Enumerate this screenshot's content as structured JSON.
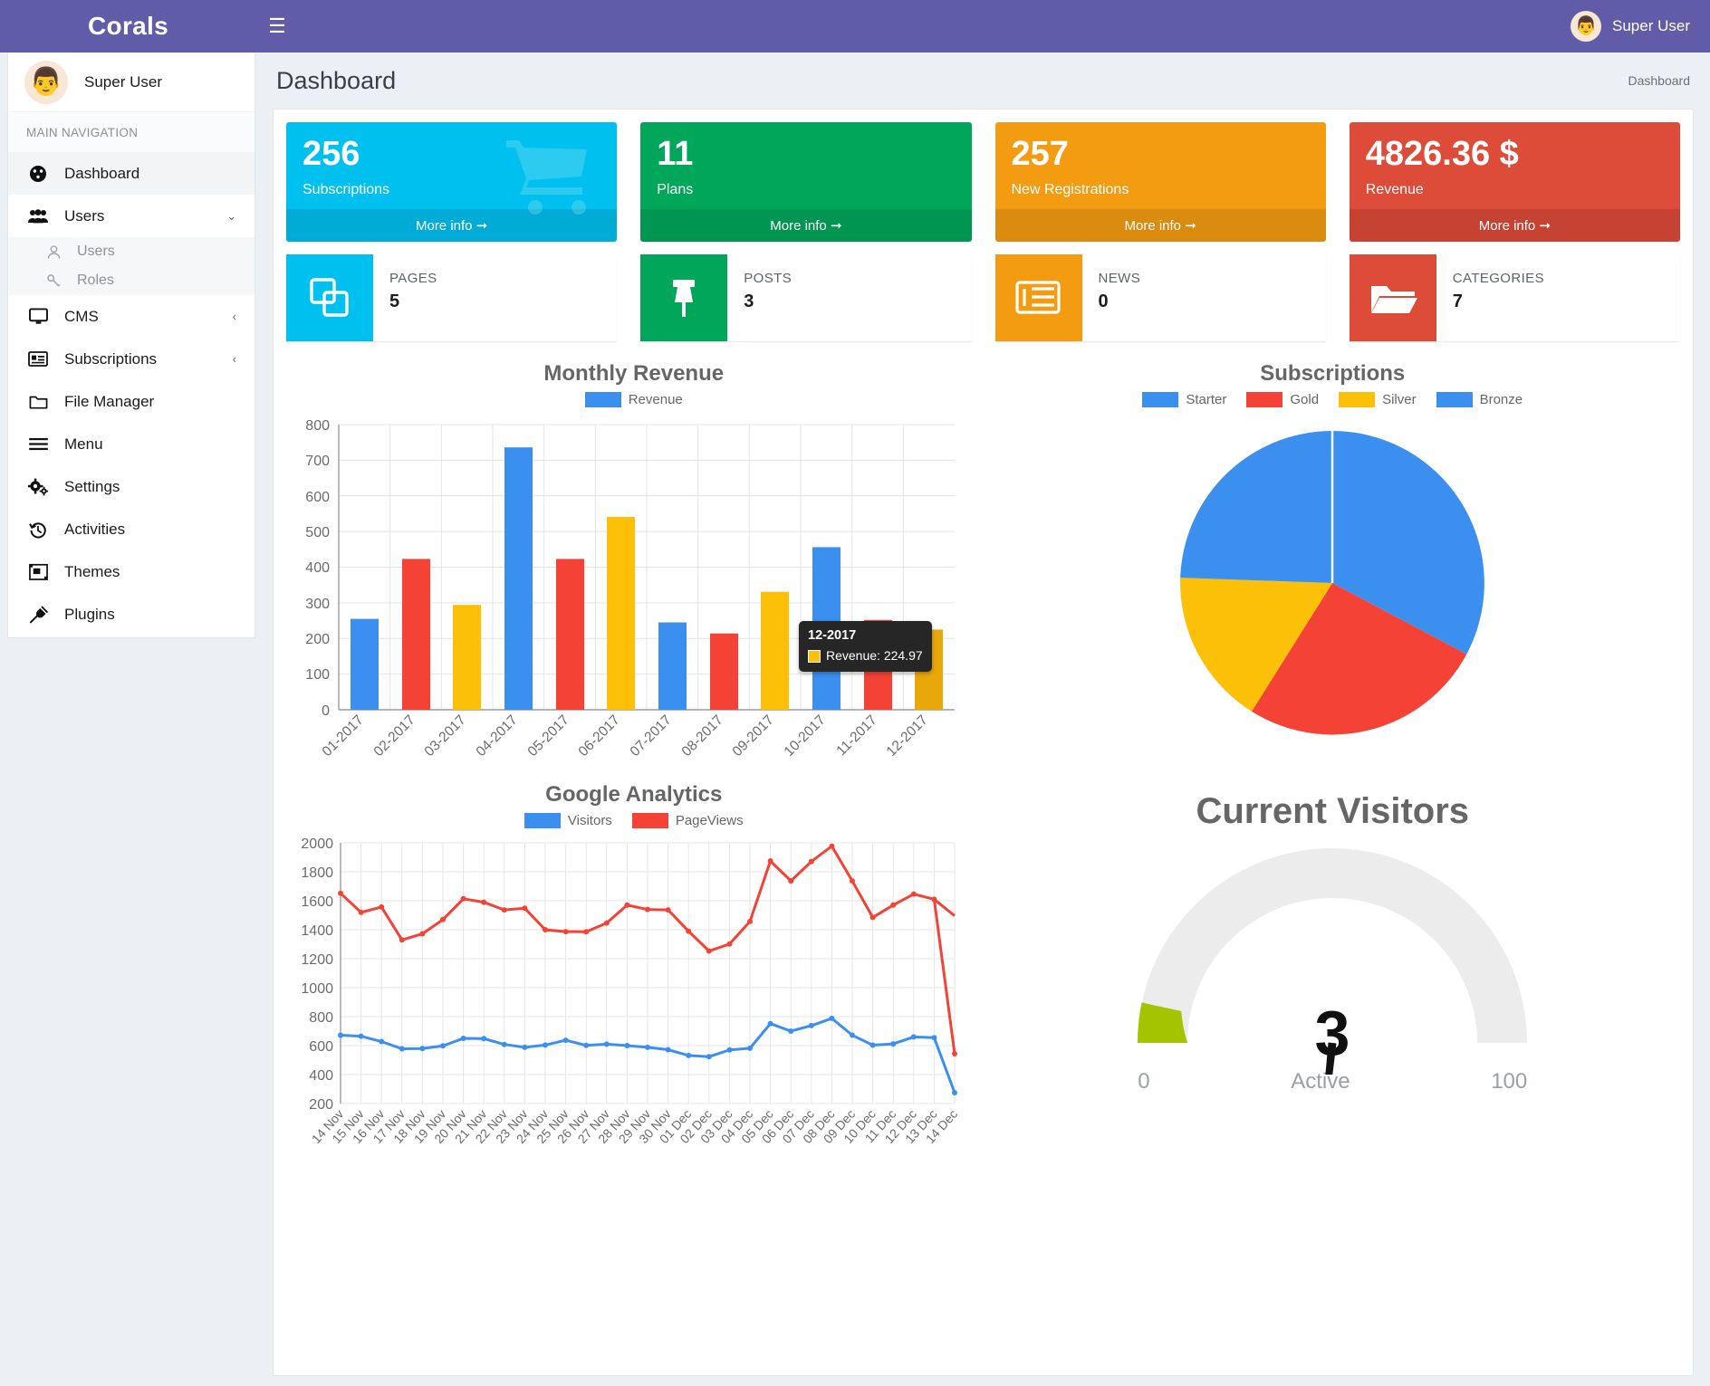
{
  "topbar": {
    "brand": "Corals",
    "menu_icon": "hamburger-icon",
    "user": "Super User"
  },
  "sidebar": {
    "user_name": "Super User",
    "section_label": "MAIN NAVIGATION",
    "items": [
      {
        "label": "Dashboard",
        "icon": "dashboard-icon",
        "active": true,
        "chevron": ""
      },
      {
        "label": "Users",
        "icon": "users-icon",
        "active": false,
        "chevron": "⌄"
      },
      {
        "label": "CMS",
        "icon": "monitor-icon",
        "active": false,
        "chevron": "‹"
      },
      {
        "label": "Subscriptions",
        "icon": "id-card-icon",
        "active": false,
        "chevron": "‹"
      },
      {
        "label": "File Manager",
        "icon": "folder-icon",
        "active": false,
        "chevron": ""
      },
      {
        "label": "Menu",
        "icon": "bars-icon",
        "active": false,
        "chevron": ""
      },
      {
        "label": "Settings",
        "icon": "gears-icon",
        "active": false,
        "chevron": ""
      },
      {
        "label": "Activities",
        "icon": "history-icon",
        "active": false,
        "chevron": ""
      },
      {
        "label": "Themes",
        "icon": "themes-icon",
        "active": false,
        "chevron": ""
      },
      {
        "label": "Plugins",
        "icon": "plug-icon",
        "active": false,
        "chevron": ""
      }
    ],
    "sub_items": [
      {
        "label": "Users",
        "icon": "user-icon"
      },
      {
        "label": "Roles",
        "icon": "key-icon"
      }
    ]
  },
  "header": {
    "title": "Dashboard",
    "breadcrumb": "Dashboard"
  },
  "stat_cards": [
    {
      "value": "256",
      "label": "Subscriptions",
      "more": "More info",
      "color": "#00c0ef",
      "icon": "shopping-cart-icon"
    },
    {
      "value": "11",
      "label": "Plans",
      "more": "More info",
      "color": "#00a65a",
      "icon": "plans-icon"
    },
    {
      "value": "257",
      "label": "New Registrations",
      "more": "More info",
      "color": "#f39c12",
      "icon": "user-plus-icon"
    },
    {
      "value": "4826.36 $",
      "label": "Revenue",
      "more": "More info",
      "color": "#dd4b39",
      "icon": "money-icon"
    }
  ],
  "info_boxes": [
    {
      "caption": "PAGES",
      "value": "5",
      "color": "#00c0ef",
      "icon": "copy-icon"
    },
    {
      "caption": "POSTS",
      "value": "3",
      "color": "#00a65a",
      "icon": "thumbtack-icon"
    },
    {
      "caption": "NEWS",
      "value": "0",
      "color": "#f39c12",
      "icon": "newspaper-icon"
    },
    {
      "caption": "CATEGORIES",
      "value": "7",
      "color": "#dd4b39",
      "icon": "folder-open-icon"
    }
  ],
  "tooltip": {
    "title": "12-2017",
    "series_label": "Revenue: 224.97",
    "swatch_color": "#fdc008"
  },
  "gauge": {
    "title": "Current Visitors",
    "value": "3",
    "unit": "Active",
    "min": "0",
    "max": "100"
  },
  "chart_data": [
    {
      "type": "bar",
      "title": "Monthly Revenue",
      "legend": [
        {
          "name": "Revenue",
          "color": "#3b8fef"
        }
      ],
      "legend_position": "top",
      "xlabel": "",
      "ylabel": "",
      "ylim": [
        0,
        800
      ],
      "yticks": [
        0,
        100,
        200,
        300,
        400,
        500,
        600,
        700,
        800
      ],
      "grid": true,
      "categories": [
        "01-2017",
        "02-2017",
        "03-2017",
        "04-2017",
        "05-2017",
        "06-2017",
        "07-2017",
        "08-2017",
        "09-2017",
        "10-2017",
        "11-2017",
        "12-2017"
      ],
      "values": [
        255,
        423,
        294,
        736,
        423,
        541,
        245,
        214,
        331,
        456,
        252,
        224.97
      ],
      "bar_colors": [
        "#3b8fef",
        "#f44336",
        "#fdc008",
        "#3b8fef",
        "#f44336",
        "#fdc008",
        "#3b8fef",
        "#f44336",
        "#fdc008",
        "#3b8fef",
        "#f44336",
        "#e8a80a"
      ]
    },
    {
      "type": "pie",
      "title": "Subscriptions",
      "legend_position": "top",
      "labels": [
        "Starter",
        "Gold",
        "Silver",
        "Bronze"
      ],
      "colors": [
        "#3b8fef",
        "#f44336",
        "#fdc008",
        "#3b8fef"
      ],
      "values": [
        25,
        30,
        25,
        20
      ],
      "slices": [
        {
          "label": "Starter",
          "color": "#3b8fef",
          "start_deg": 0,
          "end_deg": 118
        },
        {
          "label": "Gold",
          "color": "#f44336",
          "start_deg": 118,
          "end_deg": 212
        },
        {
          "label": "Silver",
          "color": "#fdc008",
          "start_deg": 212,
          "end_deg": 272
        },
        {
          "label": "Bronze",
          "color": "#3b8fef",
          "start_deg": 272,
          "end_deg": 360
        }
      ]
    },
    {
      "type": "line",
      "title": "Google Analytics",
      "legend_position": "top",
      "legend": [
        {
          "name": "Visitors",
          "color": "#3b8fef"
        },
        {
          "name": "PageViews",
          "color": "#f44336"
        }
      ],
      "xlabel": "",
      "ylabel": "",
      "ylim": [
        200,
        2000
      ],
      "yticks": [
        200,
        400,
        600,
        800,
        1000,
        1200,
        1400,
        1600,
        1800,
        2000
      ],
      "grid": true,
      "x": [
        "14 Nov",
        "15 Nov",
        "16 Nov",
        "17 Nov",
        "18 Nov",
        "19 Nov",
        "20 Nov",
        "21 Nov",
        "22 Nov",
        "23 Nov",
        "24 Nov",
        "25 Nov",
        "26 Nov",
        "27 Nov",
        "28 Nov",
        "29 Nov",
        "30 Nov",
        "01 Dec",
        "02 Dec",
        "03 Dec",
        "04 Dec",
        "05 Dec",
        "06 Dec",
        "07 Dec",
        "08 Dec",
        "09 Dec",
        "10 Dec",
        "11 Dec",
        "12 Dec",
        "13 Dec",
        "14 Dec"
      ],
      "series": [
        {
          "name": "Visitors",
          "color": "#3b8fef",
          "values": [
            672,
            665,
            628,
            578,
            580,
            598,
            650,
            648,
            608,
            588,
            604,
            637,
            602,
            610,
            600,
            588,
            572,
            532,
            524,
            570,
            582,
            752,
            700,
            738,
            788,
            672,
            603,
            612,
            660,
            655,
            634,
            325
          ]
        },
        {
          "name": "PageViews",
          "color": "#f44336",
          "values": [
            1652,
            1520,
            1557,
            1330,
            1372,
            1470,
            1614,
            1590,
            1537,
            1548,
            1400,
            1387,
            1386,
            1446,
            1570,
            1540,
            1537,
            1390,
            1228,
            1276,
            1432,
            1850,
            1712,
            1846,
            1952,
            1712,
            1460,
            1548,
            1624,
            1588,
            1474,
            645
          ]
        }
      ]
    }
  ]
}
